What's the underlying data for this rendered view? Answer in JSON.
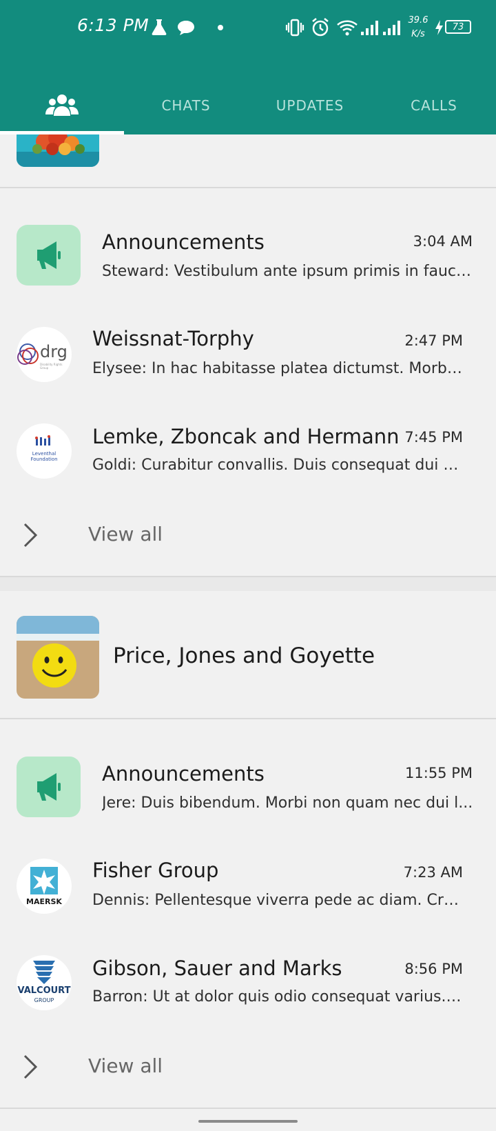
{
  "status_bar": {
    "time": "6:13 PM",
    "net_speed_value": "39.6",
    "net_speed_unit": "K/s",
    "battery": "73"
  },
  "tabs": [
    {
      "label": "",
      "icon": "communities-icon",
      "active": true
    },
    {
      "label": "CHATS",
      "active": false
    },
    {
      "label": "UPDATES",
      "active": false
    },
    {
      "label": "CALLS",
      "active": false
    }
  ],
  "communities": [
    {
      "name": "",
      "groups": [
        {
          "type": "announcement",
          "title": "Announcements",
          "time": "3:04 AM",
          "preview": "Steward: Vestibulum ante ipsum primis in fauci..."
        },
        {
          "type": "group",
          "logo": "drg-logo",
          "title": "Weissnat-Torphy",
          "time": "2:47 PM",
          "preview": "Elysee: In hac habitasse platea dictumst. Morbi ..."
        },
        {
          "type": "group",
          "logo": "foundation-logo",
          "title": "Lemke, Zboncak and Hermann",
          "time": "7:45 PM",
          "preview": "Goldi: Curabitur convallis. Duis consequat dui n..."
        }
      ],
      "view_all": "View all"
    },
    {
      "name": "Price, Jones and Goyette",
      "groups": [
        {
          "type": "announcement",
          "title": "Announcements",
          "time": "11:55 PM",
          "preview": "Jere: Duis bibendum. Morbi non quam nec dui l..."
        },
        {
          "type": "group",
          "logo": "maersk-logo",
          "title": "Fisher Group",
          "time": "7:23 AM",
          "preview": "Dennis: Pellentesque viverra pede ac diam. Cra..."
        },
        {
          "type": "group",
          "logo": "valcourt-logo",
          "title": "Gibson, Sauer and Marks",
          "time": "8:56 PM",
          "preview": "Barron: Ut at dolor quis odio consequat varius. ..."
        }
      ],
      "view_all": "View all"
    }
  ],
  "logos": {
    "drg": "drg",
    "drg_sub": "Disability Rights Group",
    "foundation": "Leventhal Foundation",
    "maersk": "MAERSK",
    "valcourt": "VALCOURT",
    "valcourt_sub": "GROUP"
  },
  "colors": {
    "header": "#128c7e",
    "announcement_bg": "#b7e8c9",
    "announcement_icon": "#1f9e72",
    "background": "#f1f1f1"
  }
}
